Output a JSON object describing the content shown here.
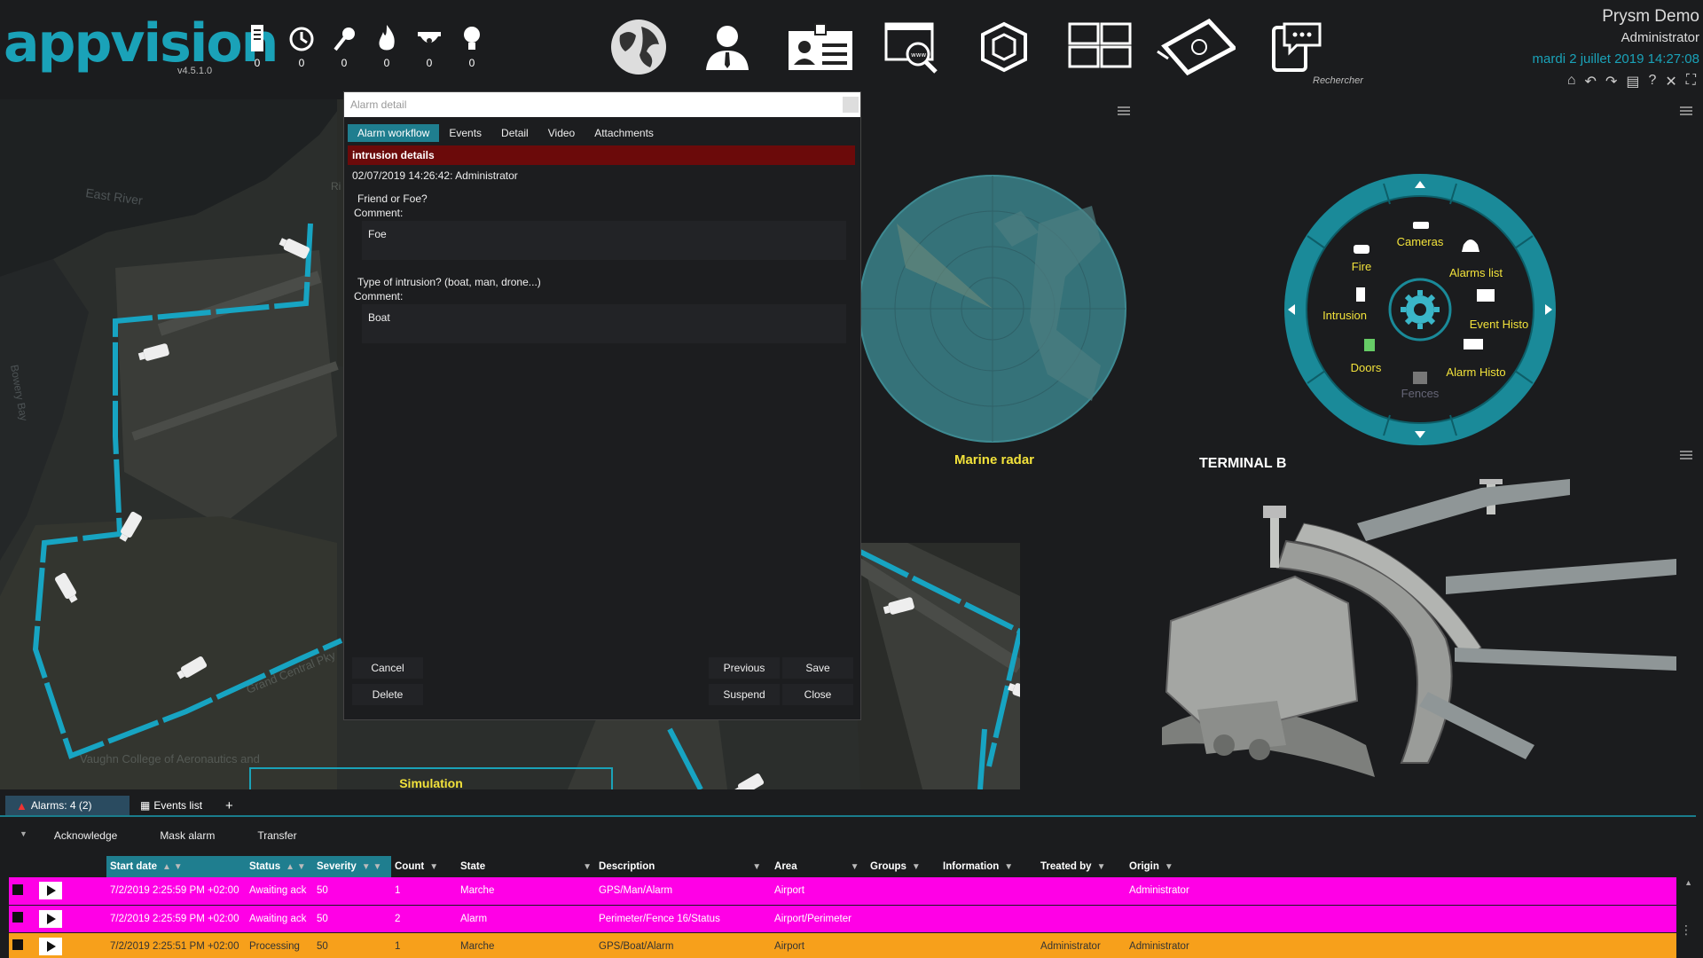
{
  "app": {
    "logo": "appvision",
    "version": "v4.5.1.0"
  },
  "counters": [
    {
      "icon": "server-icon",
      "value": "0"
    },
    {
      "icon": "timer-icon",
      "value": "0"
    },
    {
      "icon": "key-icon",
      "value": "0"
    },
    {
      "icon": "fire-icon",
      "value": "0"
    },
    {
      "icon": "dome-camera-icon",
      "value": "0"
    },
    {
      "icon": "bulb-icon",
      "value": "0"
    }
  ],
  "modules": [
    "globe-icon",
    "person-icon",
    "badge-icon",
    "web-search-icon",
    "3d-cube-icon",
    "video-wall-icon",
    "map-3d-icon",
    "chat-device-icon"
  ],
  "search": {
    "label": "Rechercher"
  },
  "user": {
    "name": "Prysm Demo",
    "role": "Administrator",
    "datetime": "mardi 2 juillet 2019 14:27:08"
  },
  "map": {
    "labels": [
      "East River",
      "Bowery Bay",
      "Grand Central Pky",
      "Vaughn College of Aeronautics and",
      "Ri"
    ],
    "simulation": "Simulation"
  },
  "radar": {
    "label": "Marine radar"
  },
  "wheel": {
    "items": [
      "Cameras",
      "Fire",
      "Alarms list",
      "Intrusion",
      "Event Histo",
      "Doors",
      "Alarm Histo",
      "Fences"
    ]
  },
  "terminal": {
    "label": "TERMINAL B"
  },
  "dialog": {
    "title": "Alarm detail",
    "tabs": [
      "Alarm workflow",
      "Events",
      "Detail",
      "Video",
      "Attachments"
    ],
    "workflow_header": "intrusion details",
    "log": "02/07/2019 14:26:42: Administrator",
    "q1": "Friend or Foe?",
    "comment_label": "Comment:",
    "a1": "Foe",
    "q2": "Type of intrusion? (boat, man, drone...)",
    "a2": "Boat",
    "buttons": {
      "cancel": "Cancel",
      "delete": "Delete",
      "previous": "Previous",
      "save": "Save",
      "suspend": "Suspend",
      "close": "Close"
    }
  },
  "bottom": {
    "tabs": {
      "alarms": "Alarms: 4 (2)",
      "events": "Events list",
      "plus": "+"
    },
    "actions": [
      "Acknowledge",
      "Mask alarm",
      "Transfer"
    ],
    "columns": [
      "Start date",
      "Status",
      "Severity",
      "Count",
      "State",
      "Description",
      "Area",
      "Groups",
      "Information",
      "Treated by",
      "Origin"
    ],
    "rows": [
      {
        "start": "7/2/2019 2:25:59 PM +02:00",
        "status": "Awaiting ack",
        "severity": "50",
        "count": "1",
        "state": "Marche",
        "description": "GPS/Man/Alarm",
        "area": "Airport",
        "groups": "",
        "information": "",
        "treated_by": "",
        "origin": "Administrator",
        "color": "#ff00e6"
      },
      {
        "start": "7/2/2019 2:25:59 PM +02:00",
        "status": "Awaiting ack",
        "severity": "50",
        "count": "2",
        "state": "Alarm",
        "description": "Perimeter/Fence 16/Status",
        "area": "Airport/Perimeter",
        "groups": "",
        "information": "",
        "treated_by": "",
        "origin": "",
        "color": "#ff00e6"
      },
      {
        "start": "7/2/2019 2:25:51 PM +02:00",
        "status": "Processing",
        "severity": "50",
        "count": "1",
        "state": "Marche",
        "description": "GPS/Boat/Alarm",
        "area": "Airport",
        "groups": "",
        "information": "",
        "treated_by": "Administrator",
        "origin": "Administrator",
        "color": "#f7a01b"
      }
    ]
  },
  "colors": {
    "accent": "#1aa2b8",
    "alarm_pink": "#ff00e6",
    "processing_orange": "#f7a01b",
    "header_red": "#6b0a0a",
    "radar_yellow": "#f2e23b"
  }
}
